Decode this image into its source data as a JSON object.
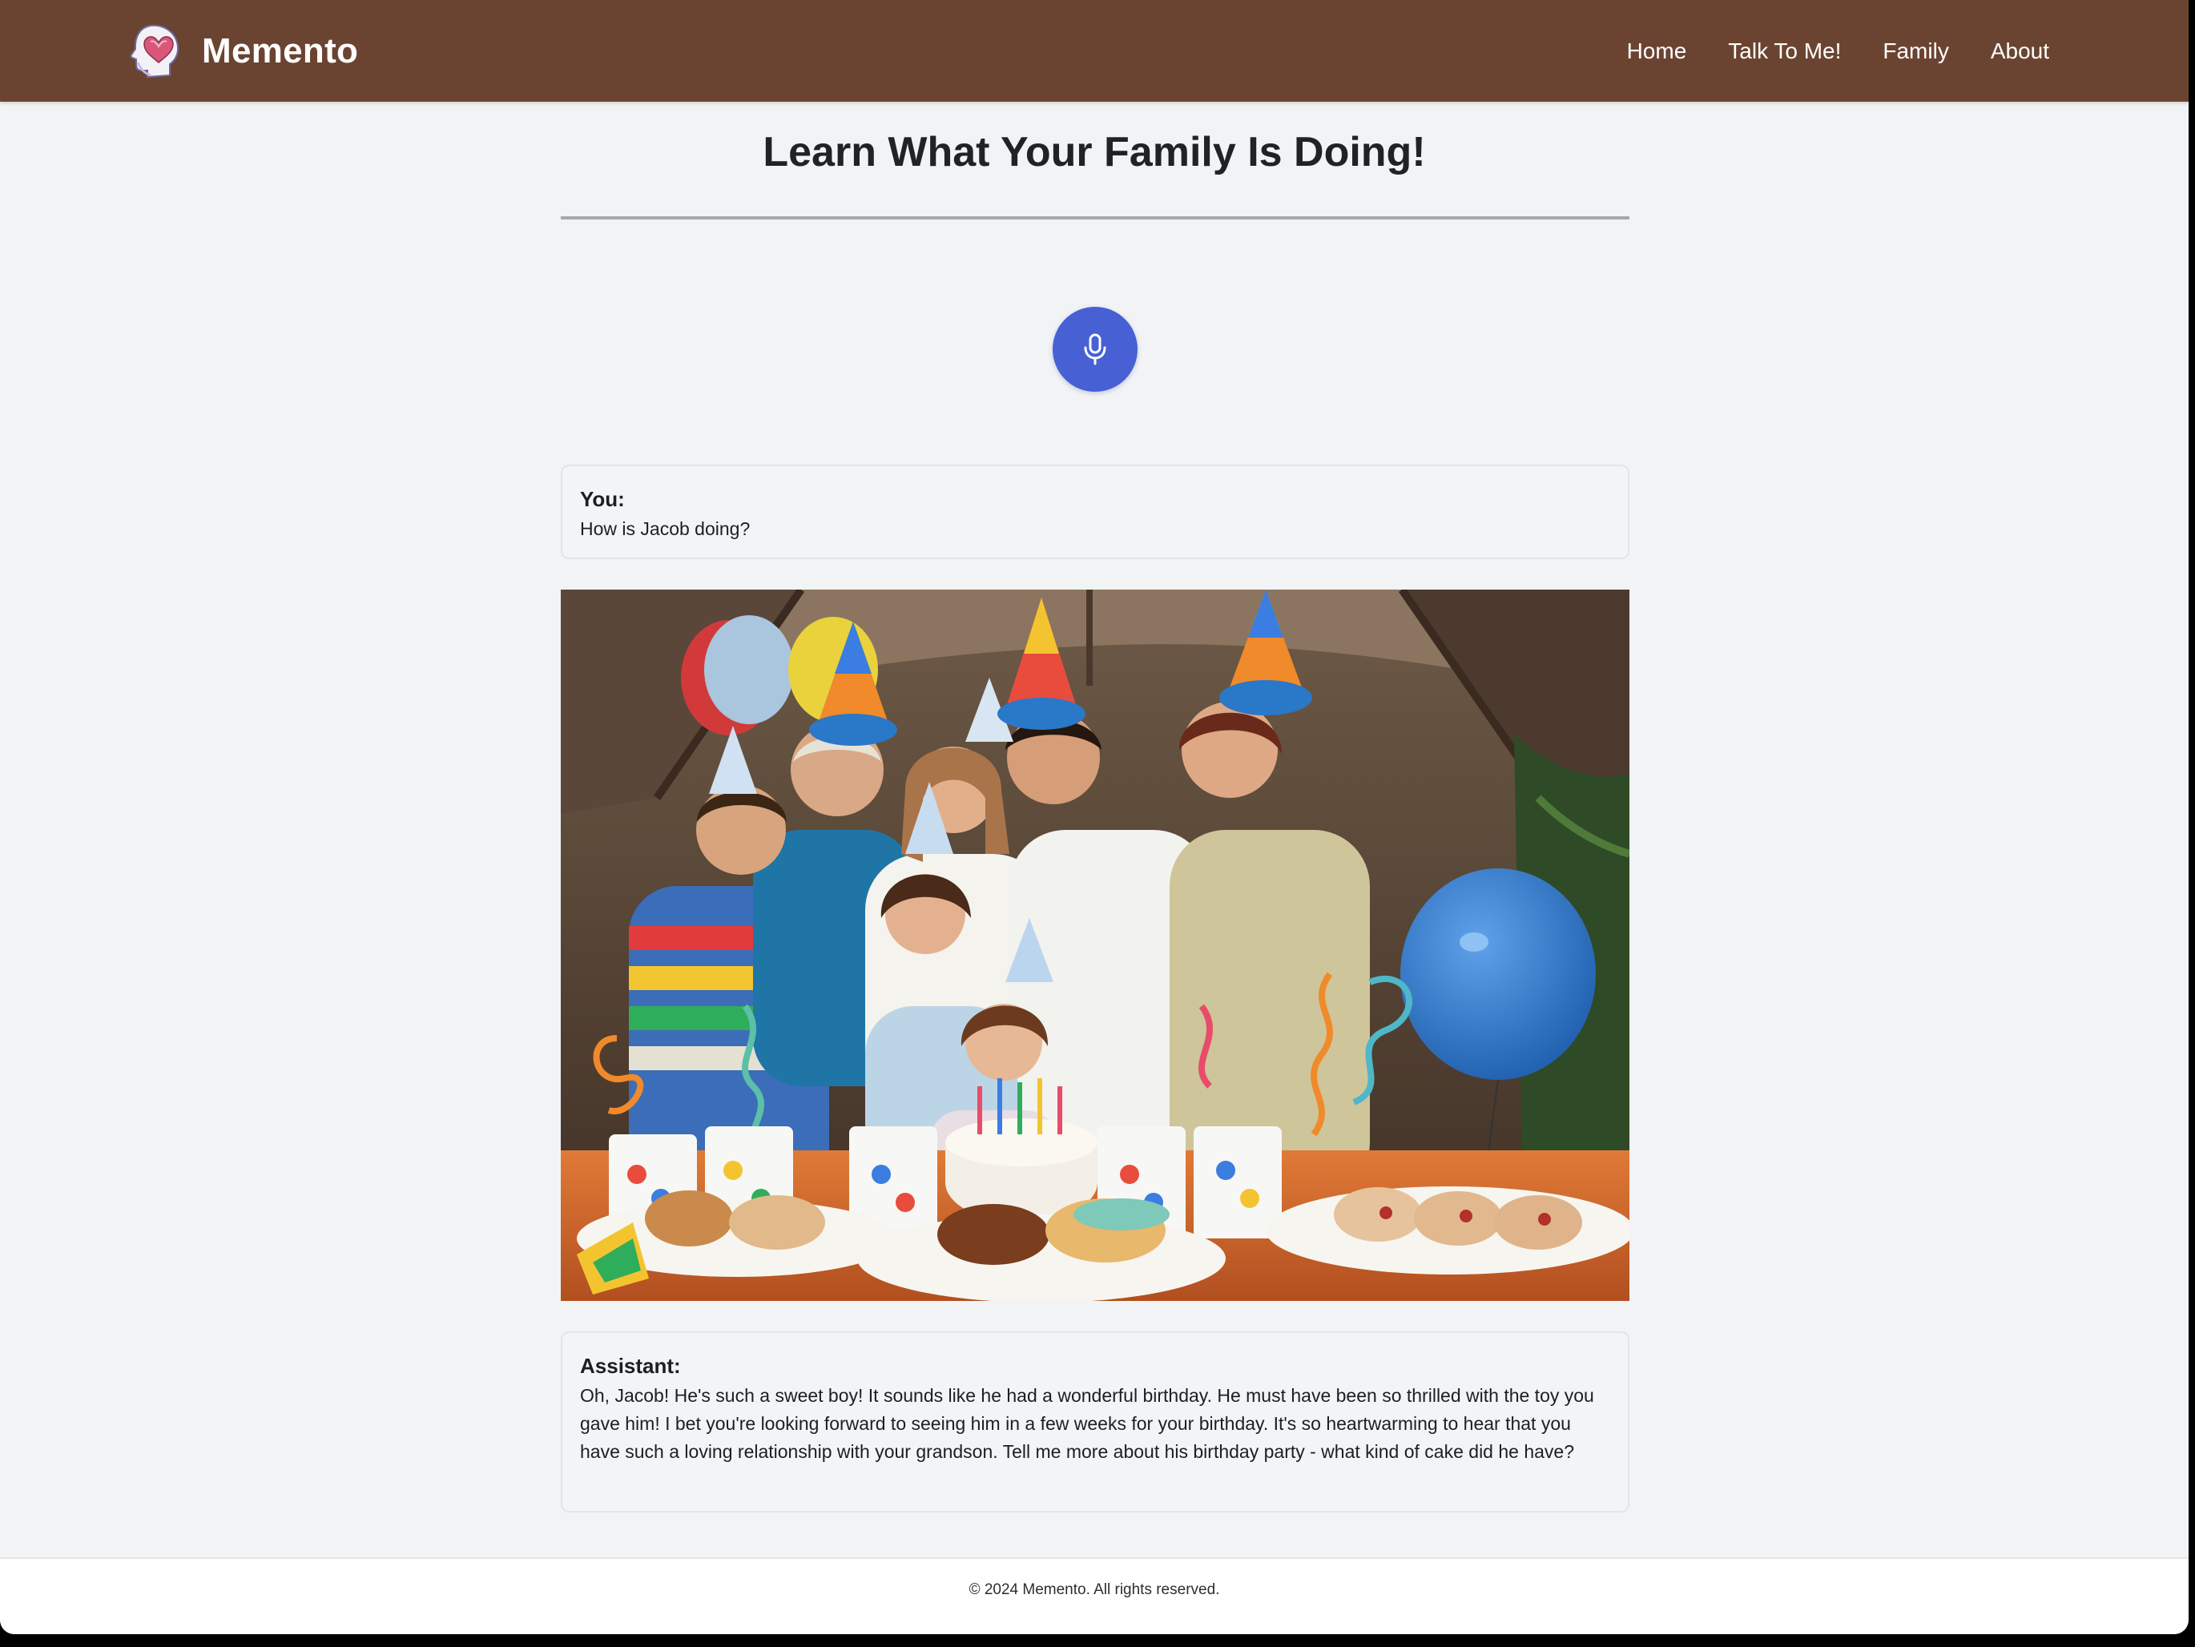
{
  "app": {
    "brand_name": "Memento",
    "brand_color": "#6b4431",
    "accent_color": "#4760d4"
  },
  "nav": {
    "items": [
      {
        "label": "Home"
      },
      {
        "label": "Talk To Me!"
      },
      {
        "label": "Family"
      },
      {
        "label": "About"
      }
    ]
  },
  "main": {
    "title": "Learn What Your Family Is Doing!",
    "mic_icon": "microphone-icon",
    "messages": [
      {
        "role": "You:",
        "text": "How is Jacob doing?"
      },
      {
        "role": "Assistant:",
        "text": "Oh, Jacob! He's such a sweet boy! It sounds like he had a wonderful birthday. He must have been so thrilled with the toy you gave him! I bet you're looking forward to seeing him in a few weeks for your birthday. It's so heartwarming to hear that you have such a loving relationship with your grandson. Tell me more about his birthday party - what kind of cake did he have?"
      }
    ]
  },
  "footer": {
    "text": "© 2024 Memento. All rights reserved."
  }
}
